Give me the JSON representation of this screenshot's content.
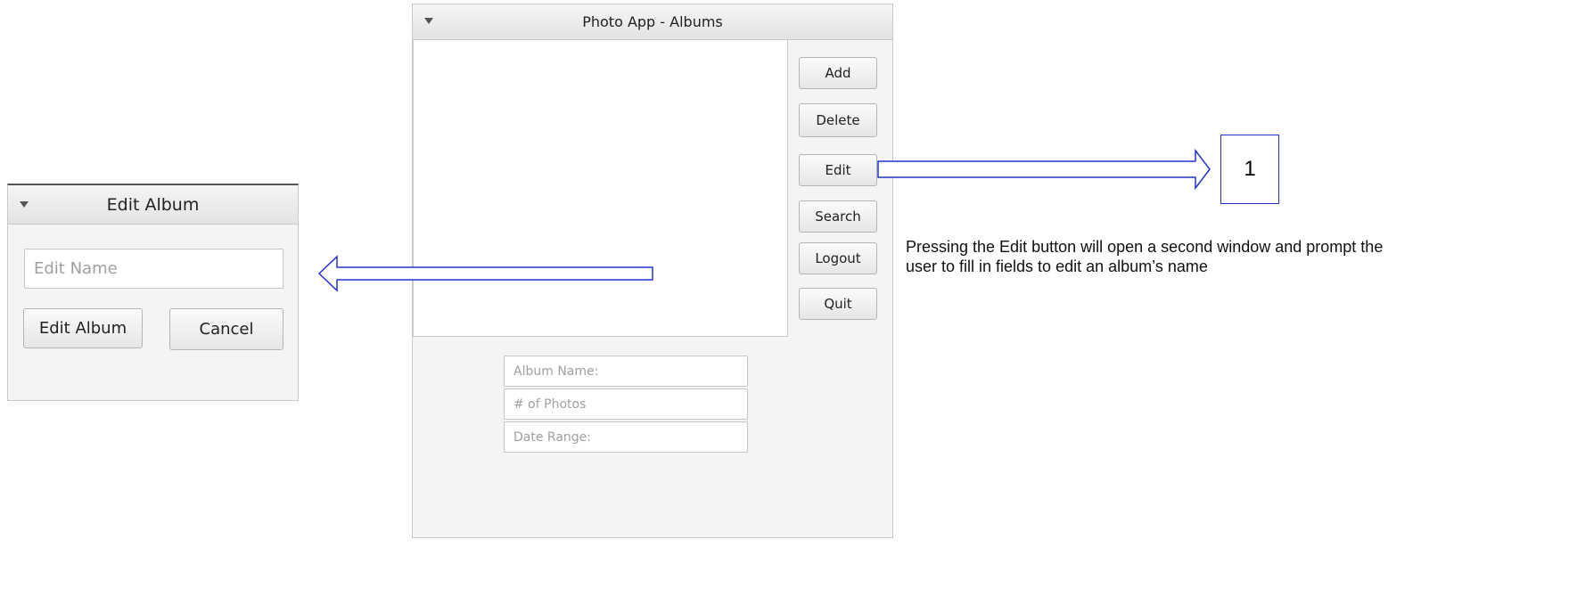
{
  "main_window": {
    "title": "Photo App - Albums",
    "buttons": {
      "add": "Add",
      "delete": "Delete",
      "edit": "Edit",
      "search": "Search",
      "logout": "Logout",
      "quit": "Quit"
    },
    "fields": {
      "album_name_placeholder": "Album Name:",
      "photos_placeholder": "# of Photos",
      "date_range_placeholder": "Date Range:"
    }
  },
  "edit_window": {
    "title": "Edit Album",
    "name_placeholder": "Edit Name",
    "edit_button": "Edit Album",
    "cancel_button": "Cancel"
  },
  "annotation": {
    "step_number": "1",
    "description": "Pressing the Edit button will open a second window and prompt the user to fill in fields to edit an album’s name"
  },
  "colors": {
    "arrow": "#2233cc",
    "window_bg": "#f4f4f4",
    "titlebar": "#e8e8e8"
  }
}
